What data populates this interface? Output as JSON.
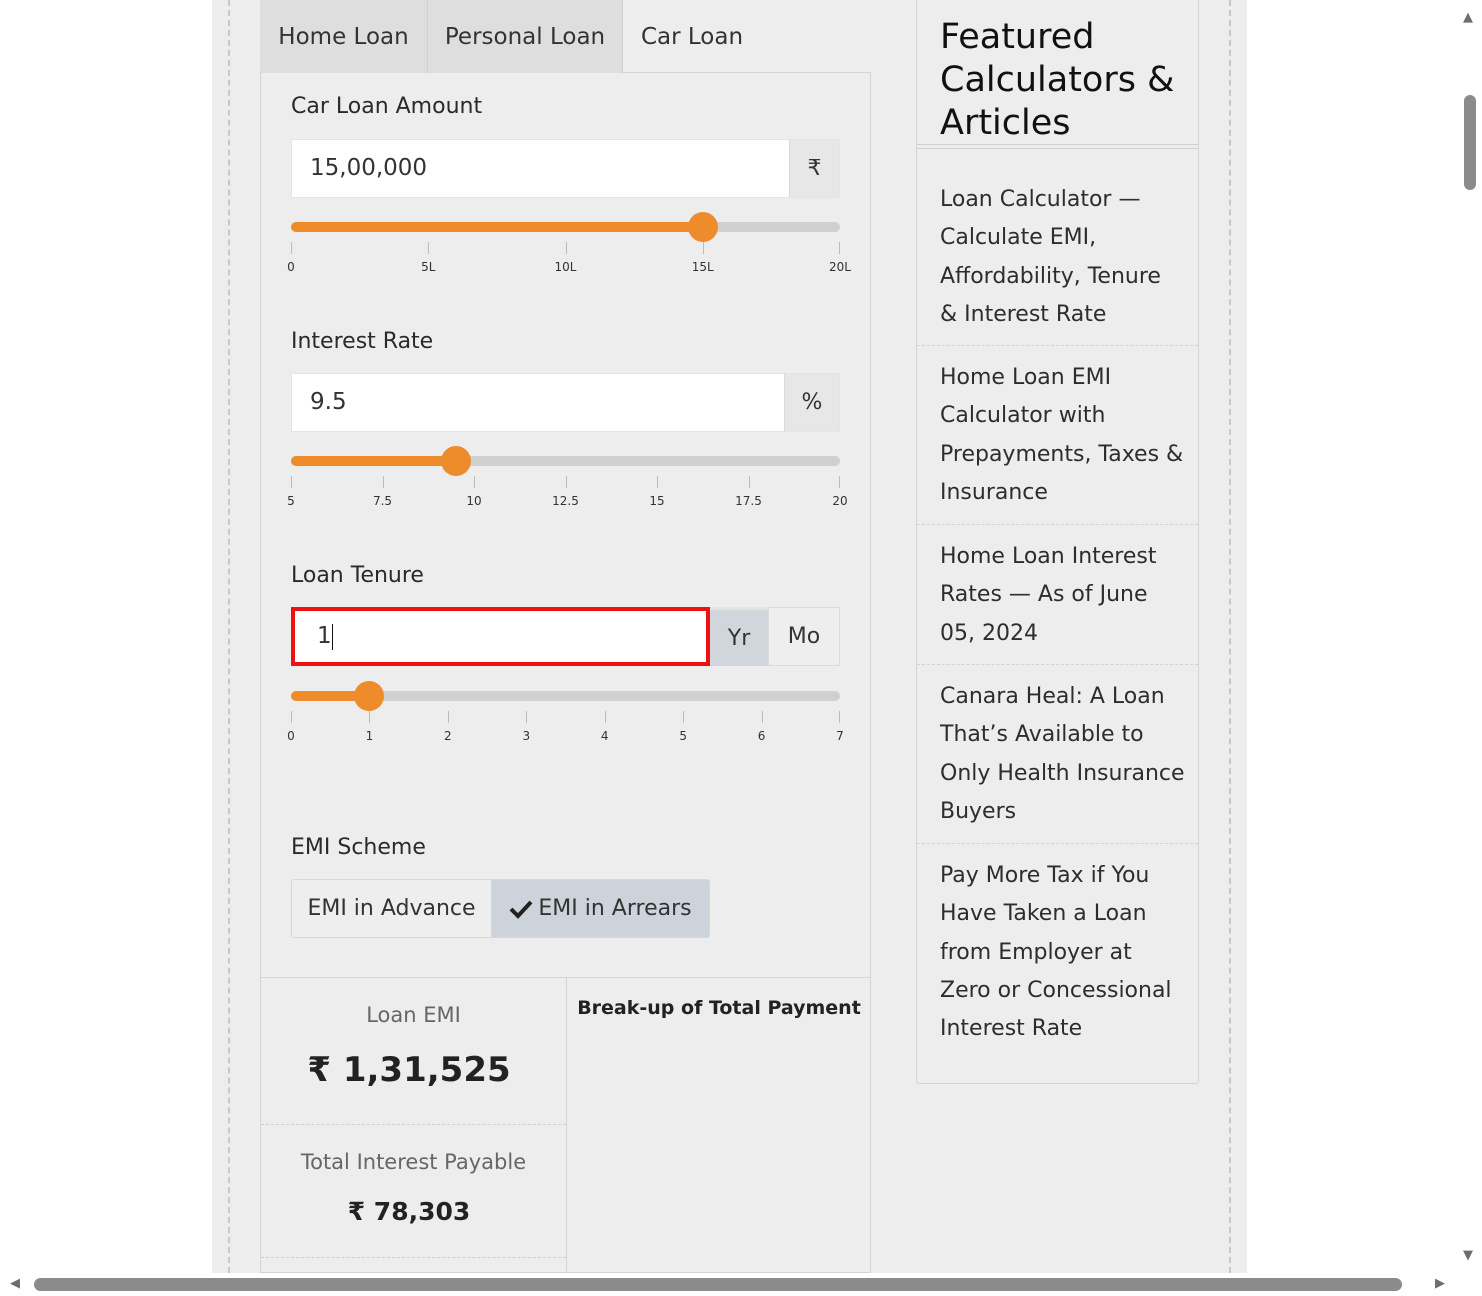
{
  "tabs": [
    {
      "label": "Home Loan",
      "active": false
    },
    {
      "label": "Personal Loan",
      "active": false
    },
    {
      "label": "Car Loan",
      "active": true
    }
  ],
  "loan_amount": {
    "label": "Car Loan Amount",
    "value": "15,00,000",
    "unit_symbol": "₹",
    "slider_value": 1500000,
    "slider_min": 0,
    "slider_max": 2000000,
    "ticks": [
      "0",
      "5L",
      "10L",
      "15L",
      "20L"
    ]
  },
  "interest_rate": {
    "label": "Interest Rate",
    "value": "9.5",
    "unit_symbol": "%",
    "slider_value": 9.5,
    "slider_min": 5,
    "slider_max": 20,
    "ticks": [
      "5",
      "7.5",
      "10",
      "12.5",
      "15",
      "17.5",
      "20"
    ]
  },
  "loan_tenure": {
    "label": "Loan Tenure",
    "value": "1",
    "unit_year": "Yr",
    "unit_month": "Mo",
    "selected_unit": "Yr",
    "slider_value": 1,
    "slider_min": 0,
    "slider_max": 7,
    "ticks": [
      "0",
      "1",
      "2",
      "3",
      "4",
      "5",
      "6",
      "7"
    ]
  },
  "emi_scheme": {
    "label": "EMI Scheme",
    "options": [
      "EMI in Advance",
      "EMI in Arrears"
    ],
    "selected": "EMI in Arrears"
  },
  "results": {
    "emi_label": "Loan EMI",
    "emi_value": "₹ 1,31,525",
    "interest_label": "Total Interest Payable",
    "interest_value": "₹ 78,303",
    "breakup_title": "Break-up of Total Payment"
  },
  "sidebar": {
    "title": "Featured Calculators & Articles",
    "articles": [
      "Loan Calculator — Calculate EMI, Affordability, Tenure & Interest Rate",
      "Home Loan EMI Calculator with Prepayments, Taxes & Insurance",
      "Home Loan Interest Rates — As of June 05, 2024",
      "Canara Heal: A Loan That’s Available to Only Health Insurance Buyers",
      "Pay More Tax if You Have Taken a Loan from Employer at Zero or Concessional Interest Rate"
    ]
  },
  "colors": {
    "accent": "#ee8c2c",
    "focus_border": "#ee1111",
    "selected_button": "#ccd3da"
  }
}
